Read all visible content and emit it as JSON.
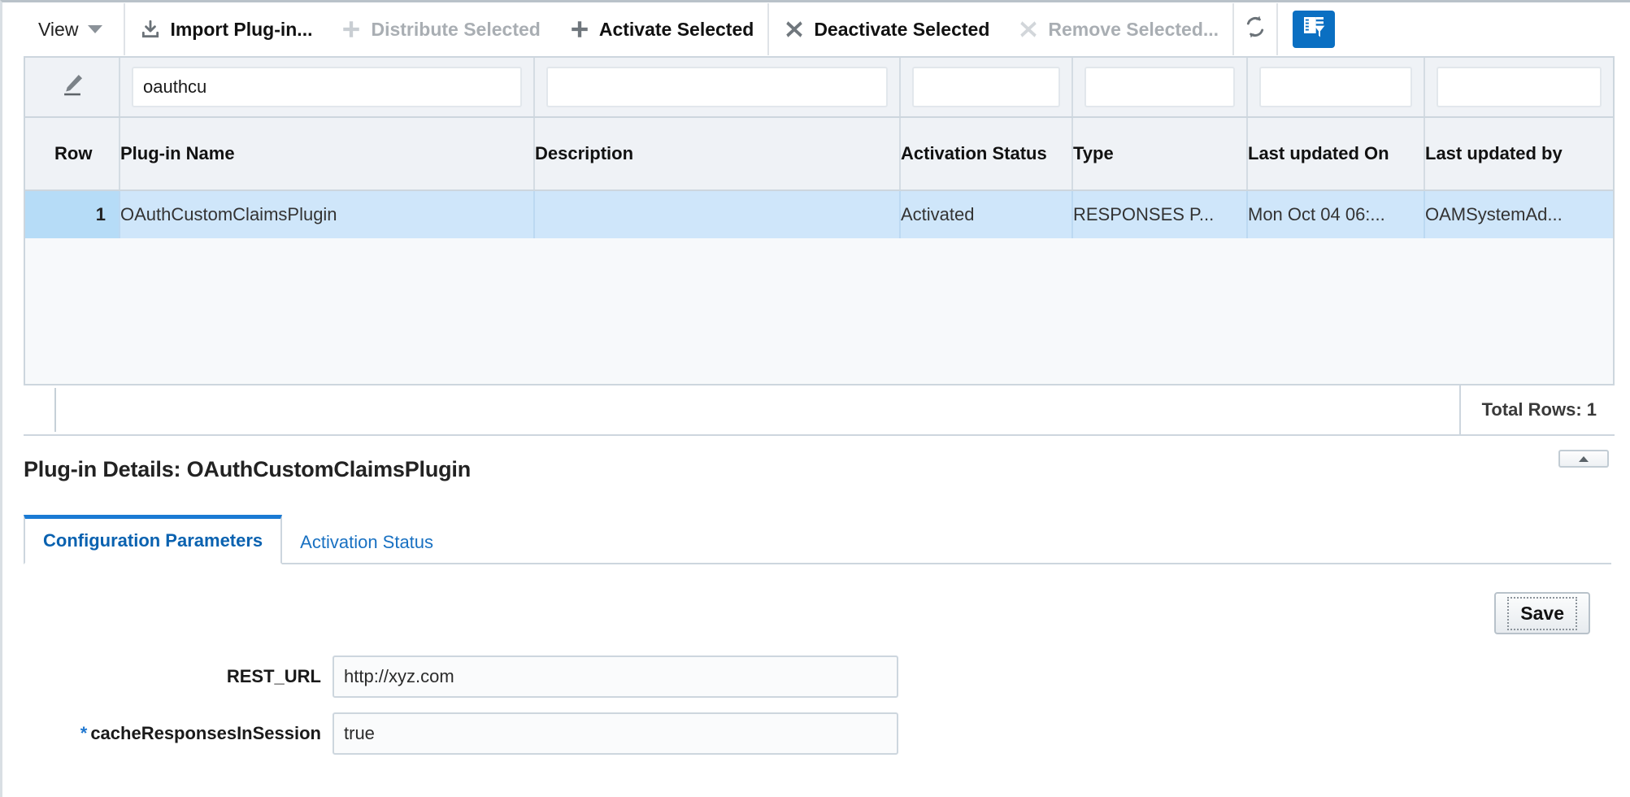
{
  "toolbar": {
    "view_label": "View",
    "view_caret_icon": "chevron-down-icon",
    "items": [
      {
        "label": "Import Plug-in...",
        "icon": "import-download-icon",
        "disabled": false
      },
      {
        "label": "Distribute Selected",
        "icon": "plus-icon",
        "disabled": true
      },
      {
        "label": "Activate Selected",
        "icon": "plus-icon",
        "disabled": false
      },
      {
        "label": "Deactivate Selected",
        "icon": "x-cross-icon",
        "disabled": false
      },
      {
        "label": "Remove Selected...",
        "icon": "x-cross-icon",
        "disabled": true
      }
    ],
    "refresh_icon": "refresh-icon",
    "query_by_example_icon": "table-filter-icon",
    "accent_color": "#0a6fc2"
  },
  "table": {
    "filter_icon": "query-pen-icon",
    "filters": [
      {
        "name": "plug-in-name",
        "value": "oauthcu",
        "placeholder": ""
      },
      {
        "name": "description",
        "value": "",
        "placeholder": ""
      },
      {
        "name": "activation-status",
        "value": "",
        "placeholder": ""
      },
      {
        "name": "type",
        "value": "",
        "placeholder": ""
      },
      {
        "name": "last-updated-on",
        "value": "",
        "placeholder": ""
      },
      {
        "name": "last-updated-by",
        "value": "",
        "placeholder": ""
      }
    ],
    "columns": [
      "Row",
      "Plug-in Name",
      "Description",
      "Activation Status",
      "Type",
      "Last updated On",
      "Last updated by"
    ],
    "rows": [
      {
        "row": "1",
        "name": "OAuthCustomClaimsPlugin",
        "description": "",
        "activation_status": "Activated",
        "type": "RESPONSES P...",
        "last_updated_on": "Mon Oct 04 06:...",
        "last_updated_by": "OAMSystemAd..."
      }
    ],
    "total_rows_label": "Total Rows: 1",
    "splitter_icon": "collapse-up-icon"
  },
  "details": {
    "title": "Plug-in Details: OAuthCustomClaimsPlugin",
    "tabs": [
      {
        "label": "Configuration Parameters",
        "active": true
      },
      {
        "label": "Activation Status",
        "active": false
      }
    ],
    "save_label": "Save",
    "fields": [
      {
        "label": "REST_URL",
        "required": false,
        "value": "http://xyz.com",
        "placeholder": ""
      },
      {
        "label": "cacheResponsesInSession",
        "required": true,
        "value": "true",
        "placeholder": ""
      }
    ],
    "required_marker": "*"
  }
}
